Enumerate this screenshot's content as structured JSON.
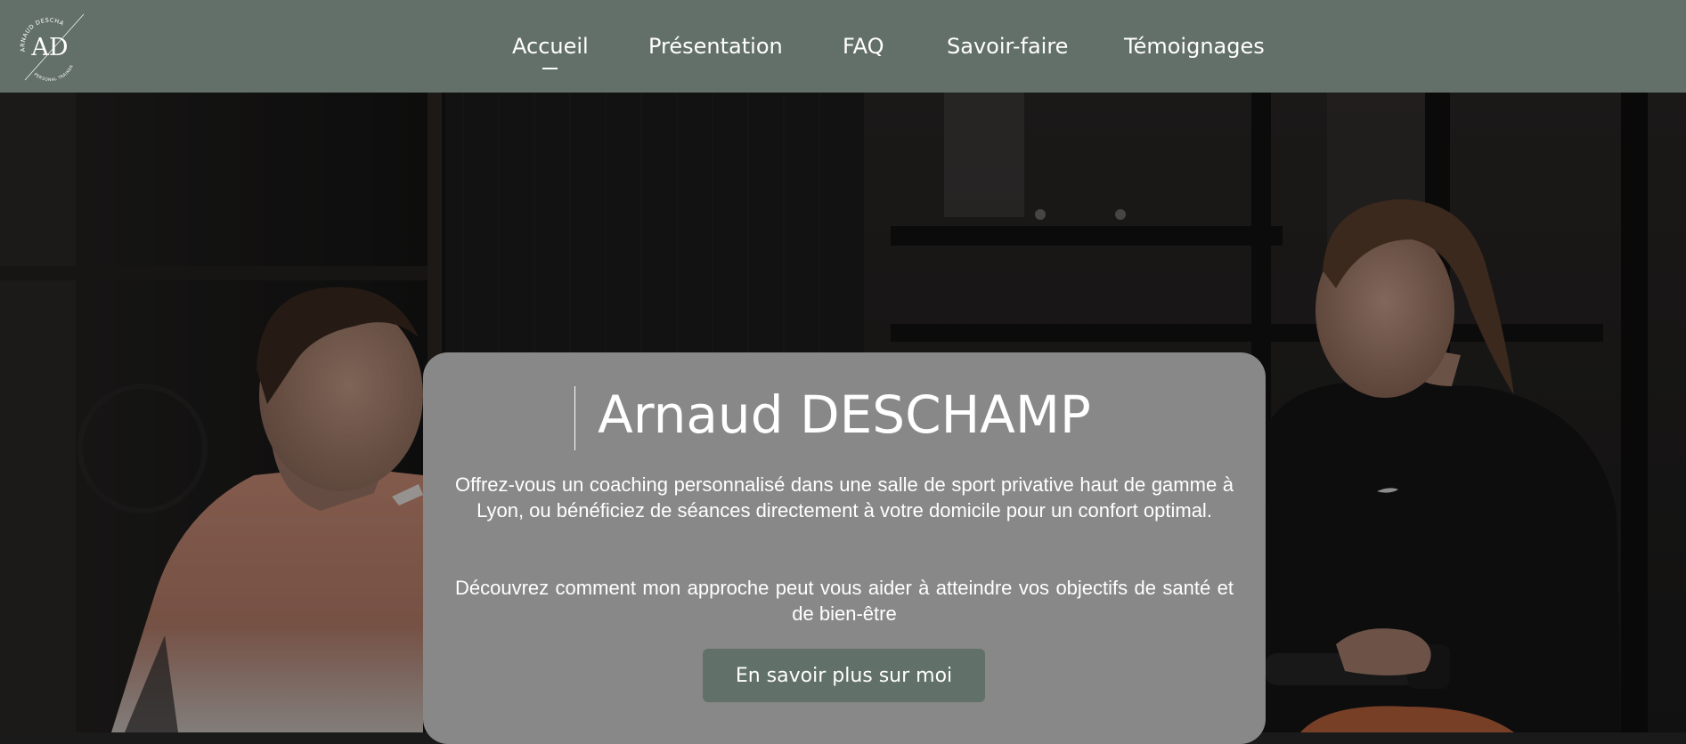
{
  "logo": {
    "monogram": "AD",
    "arc_top": "ARNAUD DESCHAMP",
    "arc_bottom": "PERSONAL TRAINER"
  },
  "nav": {
    "items": [
      {
        "label": "Accueil",
        "active": true
      },
      {
        "label": "Présentation"
      },
      {
        "label": "FAQ"
      },
      {
        "label": "Savoir-faire"
      },
      {
        "label": "Témoignages"
      }
    ]
  },
  "hero": {
    "title": "Arnaud DESCHAMP",
    "paragraph_1": "Offrez-vous un coaching personnalisé dans une salle de sport privative haut de gamme à Lyon, ou bénéficiez de séances directement à votre domicile pour un confort optimal.",
    "paragraph_2": "Découvrez comment mon approche peut vous aider à atteindre vos objectifs de santé et de bien-être",
    "cta_label": "En savoir plus sur moi"
  },
  "colors": {
    "header_bg": "#637069",
    "card_bg": "#888888",
    "button_bg": "#617069",
    "text": "#ffffff"
  }
}
